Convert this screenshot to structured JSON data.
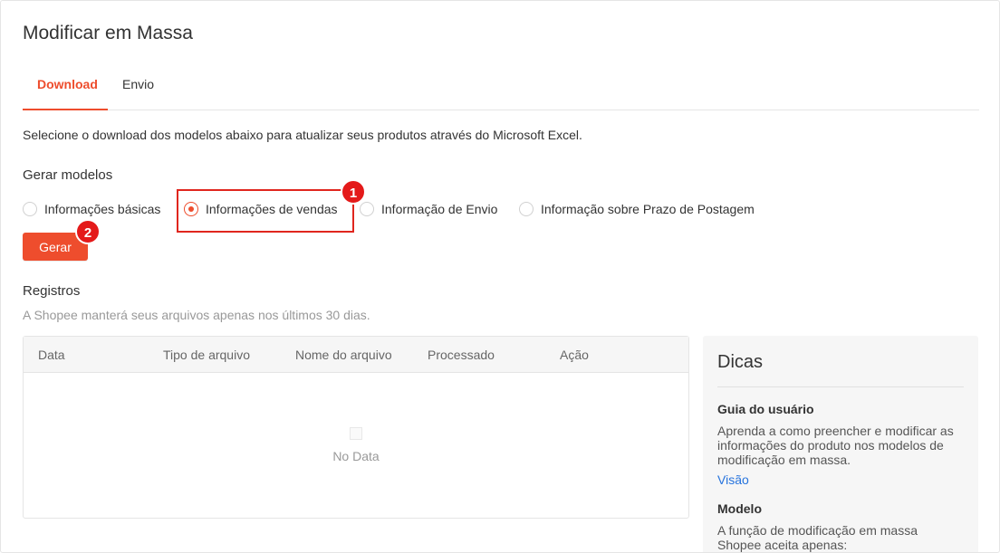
{
  "page": {
    "title": "Modificar em Massa",
    "description": "Selecione o download dos modelos abaixo para atualizar seus produtos através do Microsoft Excel."
  },
  "tabs": [
    {
      "label": "Download",
      "active": true
    },
    {
      "label": "Envio",
      "active": false
    }
  ],
  "generate": {
    "title": "Gerar modelos",
    "options": [
      {
        "label": "Informações básicas",
        "checked": false
      },
      {
        "label": "Informações de vendas",
        "checked": true
      },
      {
        "label": "Informação de Envio",
        "checked": false
      },
      {
        "label": "Informação sobre Prazo de Postagem",
        "checked": false
      }
    ],
    "button_label": "Gerar"
  },
  "annotations": {
    "step1": "1",
    "step2": "2"
  },
  "records": {
    "title": "Registros",
    "subtitle": "A Shopee manterá seus arquivos apenas nos últimos 30 dias.",
    "columns": [
      "Data",
      "Tipo de arquivo",
      "Nome do arquivo",
      "Processado",
      "Ação"
    ],
    "empty_text": "No Data"
  },
  "tips": {
    "title": "Dicas",
    "guide_title": "Guia do usuário",
    "guide_text": "Aprenda a como preencher e modificar as informações do produto nos modelos de modificação em massa.",
    "guide_link": "Visão",
    "model_title": "Modelo",
    "model_text": "A função de modificação em massa Shopee aceita apenas:"
  },
  "colors": {
    "accent": "#ee4d2d",
    "link": "#2673dd",
    "annotation": "#e41a1a"
  }
}
